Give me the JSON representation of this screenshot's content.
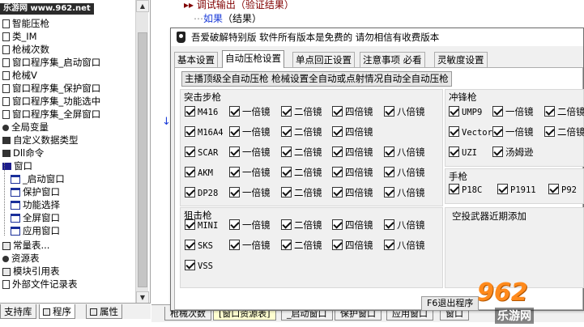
{
  "site_label": "乐游网 www.962.net",
  "tree": {
    "items": [
      {
        "label": "智能压枪",
        "icon": "doc-icon"
      },
      {
        "label": "类_IM",
        "icon": "doc-icon"
      },
      {
        "label": "枪械次数",
        "icon": "doc-icon"
      },
      {
        "label": "窗口程序集_启动窗口",
        "icon": "doc-icon"
      },
      {
        "label": "枪械V",
        "icon": "doc-icon"
      },
      {
        "label": "窗口程序集_保护窗口",
        "icon": "doc-icon"
      },
      {
        "label": "窗口程序集_功能选中",
        "icon": "doc-icon"
      },
      {
        "label": "窗口程序集_全屏窗口",
        "icon": "doc-icon"
      },
      {
        "label": "全局变量",
        "icon": "globe-icon"
      },
      {
        "label": "自定义数据类型",
        "icon": "type-icon"
      },
      {
        "label": "Dll命令",
        "icon": "dll-icon"
      },
      {
        "label": "窗口",
        "icon": "folder-icon"
      },
      {
        "label": "_启动窗口",
        "icon": "window-icon"
      },
      {
        "label": "保护窗口",
        "icon": "window-icon"
      },
      {
        "label": "功能选择",
        "icon": "window-icon"
      },
      {
        "label": "全屏窗口",
        "icon": "window-icon"
      },
      {
        "label": "应用窗口",
        "icon": "window-icon"
      },
      {
        "label": "常量表...",
        "icon": "const-icon"
      },
      {
        "label": "资源表",
        "icon": "resource-icon"
      },
      {
        "label": "模块引用表",
        "icon": "module-icon"
      },
      {
        "label": "外部文件记录表",
        "icon": "file-icon"
      }
    ],
    "bottom_tabs": [
      "支持库",
      "程序",
      "属性"
    ]
  },
  "code": {
    "line1_prefix": "▸▸",
    "line1": "调试输出（验证结果）",
    "line2_kw": "如果",
    "line2": "（结果）",
    "bottom_tabs": [
      "枪械次数",
      "[窗口资源表]",
      "_启动窗口",
      "保护窗口",
      "应用窗口",
      "窗口"
    ]
  },
  "dialog": {
    "title": "吾爱破解特别版 软件所有版本是免费的 请勿相信有收费版本",
    "tabs": [
      "基本设置",
      "自动压枪设置",
      "单点回正设置",
      "注意事项 必看",
      "灵敏度设置"
    ],
    "active_tab": 1,
    "main_button": "主播顶级全自动压枪 枪械设置全自动或点射情况自动全自动压枪",
    "groups": {
      "assault": {
        "title": "突击步枪",
        "rows": [
          {
            "gun": "M416",
            "scopes": [
              "一倍镜",
              "二倍镜",
              "四倍镜",
              "八倍镜"
            ]
          },
          {
            "gun": "M16A4",
            "scopes": [
              "一倍镜",
              "二倍镜",
              "四倍镜"
            ]
          },
          {
            "gun": "SCAR",
            "scopes": [
              "一倍镜",
              "二倍镜",
              "四倍镜",
              "八倍镜"
            ]
          },
          {
            "gun": "AKM",
            "scopes": [
              "一倍镜",
              "二倍镜",
              "四倍镜",
              "八倍镜"
            ]
          },
          {
            "gun": "DP28",
            "scopes": [
              "一倍镜",
              "二倍镜",
              "四倍镜",
              "八倍镜"
            ]
          }
        ]
      },
      "sniper": {
        "title": "狙击枪",
        "rows": [
          {
            "gun": "MINI",
            "scopes": [
              "一倍镜",
              "二倍镜",
              "四倍镜",
              "八倍镜"
            ]
          },
          {
            "gun": "SKS",
            "scopes": [
              "一倍镜",
              "二倍镜",
              "四倍镜",
              "八倍镜"
            ]
          },
          {
            "gun": "VSS",
            "scopes": []
          }
        ]
      },
      "smg": {
        "title": "冲锋枪",
        "rows": [
          {
            "gun": "UMP9",
            "scopes": [
              "一倍镜",
              "二倍镜"
            ]
          },
          {
            "gun": "Vector",
            "scopes": [
              "一倍镜",
              "二倍镜"
            ]
          },
          {
            "gun": "UZI",
            "scopes": [
              "汤姆逊"
            ]
          }
        ]
      },
      "pistol": {
        "title": "手枪",
        "items": [
          "P18C",
          "P1911",
          "P92"
        ]
      },
      "airdrop": {
        "title": "空投武器近期添加"
      }
    },
    "exit_button": "F6退出程序"
  },
  "watermark": {
    "number": "962",
    "sub": "乐游网"
  }
}
